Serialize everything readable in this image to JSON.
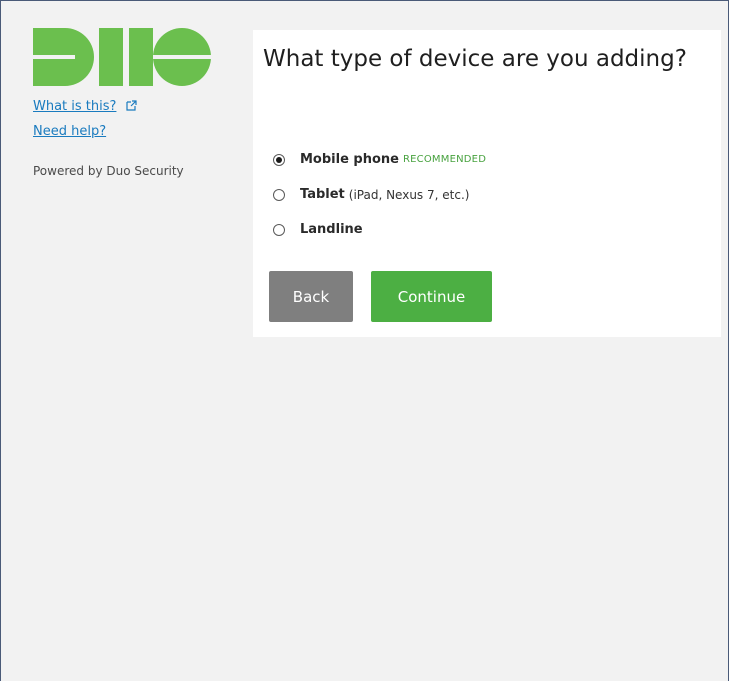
{
  "sidebar": {
    "what_is_this": "What is this?",
    "need_help": "Need help?",
    "powered_by": "Powered by Duo Security",
    "logo_icon": "duo-logo",
    "external_icon": "external-link-icon"
  },
  "panel": {
    "title": "What type of device are you adding?",
    "options": [
      {
        "label": "Mobile phone",
        "detail": "",
        "badge": "RECOMMENDED",
        "selected": true
      },
      {
        "label": "Tablet",
        "detail": "(iPad, Nexus 7, etc.)",
        "badge": "",
        "selected": false
      },
      {
        "label": "Landline",
        "detail": "",
        "badge": "",
        "selected": false
      }
    ],
    "back_label": "Back",
    "continue_label": "Continue"
  },
  "colors": {
    "brand_green": "#6bbf4e",
    "link_blue": "#1a7bbf",
    "continue_green": "#4caf43",
    "back_gray": "#7f7f7f",
    "recommended_green": "#48a23f"
  }
}
